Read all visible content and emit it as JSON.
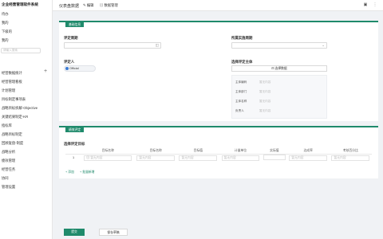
{
  "sidebar": {
    "title": "企业经营管理软件系统",
    "items": [
      "待办",
      "我的",
      "下级的",
      "我的"
    ],
    "search_placeholder": "请输入搜索",
    "plus_icon": "plus-icon",
    "menu": [
      "经营数据统计",
      "经营管理看板",
      "计划管理",
      "目标制定事项表",
      "战略目标拆解-Objective",
      "关键结果制定-KR",
      "指标库",
      "战略目标制定",
      "回顾复盘-制度",
      "战略分析",
      "绩效管理",
      "经营任务",
      "协同",
      "管理设置"
    ],
    "active_index": 10
  },
  "topbar": {
    "title": "仪表盘数据",
    "edit_label": "编辑",
    "manage_label": "数据管理"
  },
  "section1": {
    "tag": "基础信息",
    "period_label": "评定周期",
    "dept_label": "所属实施周期",
    "person_label": "评定人",
    "person_value": "Official",
    "subject_label": "选择评定主体",
    "select_btn": "选择数据",
    "info_rows": [
      {
        "k": "主体编码",
        "v": "暂无内容"
      },
      {
        "k": "主体部门",
        "v": "暂无内容"
      },
      {
        "k": "主体名称",
        "v": "暂无内容"
      },
      {
        "k": "负责人",
        "v": "暂无内容"
      }
    ]
  },
  "section2": {
    "tag": "绩效评定",
    "table_title": "选择评定目标",
    "columns": [
      "",
      "目标名称",
      "目标名称",
      "目标值",
      "计量单位",
      "实际值",
      "达成率",
      "考核百分比"
    ],
    "row": {
      "index": "1",
      "cells": [
        "暂无内容",
        "暂无内容",
        "暂无内容",
        "暂无内容",
        "",
        "暂无内容",
        "暂无内容"
      ]
    },
    "add_label": "+ 添加",
    "batch_label": "+ 批量新增"
  },
  "footer": {
    "submit_label": "提交",
    "save_label": "保存草稿"
  },
  "colors": {
    "accent": "#1f8a6b"
  }
}
